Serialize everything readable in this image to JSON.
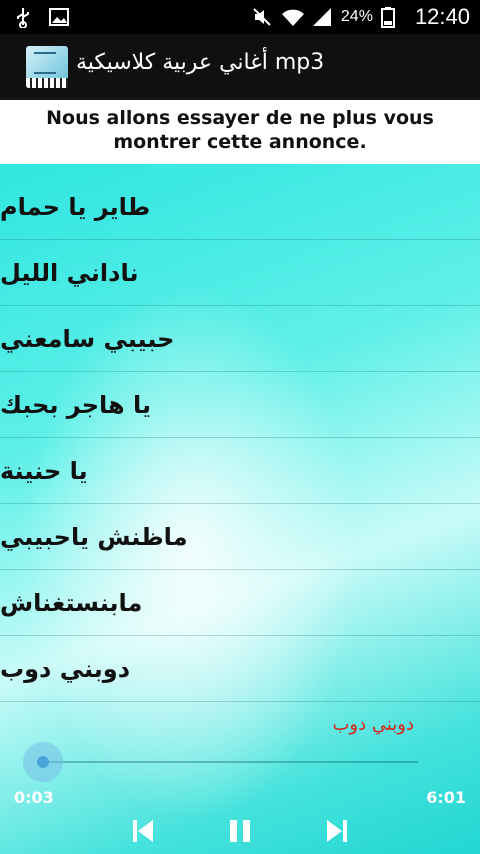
{
  "status_bar": {
    "battery": "24%",
    "time": "12:40"
  },
  "app": {
    "title": "أغاني عربية كلاسيكية mp3"
  },
  "ad": {
    "text": "Nous allons essayer de ne plus vous montrer cette annonce."
  },
  "songs": [
    "طاير يا حمام",
    "ناداني الليل",
    "حبيبي سامعني",
    "يا هاجر بحبك",
    "يا حنينة",
    "ماظنش ياحبيبي",
    "مابنستغناش",
    "دوبني دوب"
  ],
  "player": {
    "now_playing": "دوبني دوب",
    "elapsed": "0:03",
    "total": "6:01",
    "progress": 0.008
  },
  "colors": {
    "accent": "#4aa6d8",
    "now_playing": "#d8241c"
  }
}
